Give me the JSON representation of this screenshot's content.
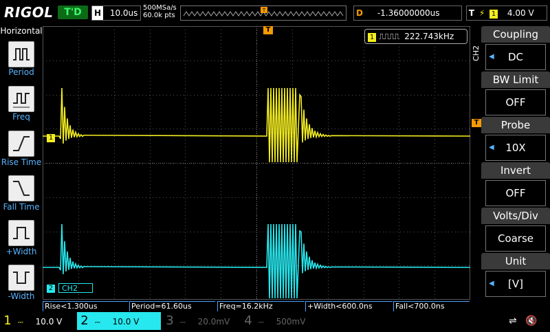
{
  "brand": "RIGOL",
  "trigger_status": "T'D",
  "horizontal": {
    "label": "H",
    "timebase": "10.0us"
  },
  "acquisition": {
    "sample_rate": "500MSa/s",
    "points": "60.0k pts"
  },
  "delay": {
    "label": "D",
    "value": "-1.36000000us"
  },
  "trigger": {
    "label": "T",
    "edge_icon": "rising-edge-icon",
    "source": "1",
    "level": "4.00 V"
  },
  "left_panel": {
    "title": "Horizontal",
    "buttons": [
      {
        "label": "Period",
        "icon": "period-icon"
      },
      {
        "label": "Freq",
        "icon": "freq-icon"
      },
      {
        "label": "Rise Time",
        "icon": "rise-time-icon"
      },
      {
        "label": "Fall Time",
        "icon": "fall-time-icon"
      },
      {
        "label": "+Width",
        "icon": "pos-width-icon"
      },
      {
        "label": "-Width",
        "icon": "neg-width-icon"
      }
    ]
  },
  "freq_counter": {
    "channel": "1",
    "value": "222.743kHz"
  },
  "channel_markers": {
    "ch1": "1",
    "ch2": "2",
    "ch2_label": "CH2",
    "trigger_marker": "T"
  },
  "right_menu": {
    "channel": "CH2",
    "items": [
      {
        "title": "Coupling",
        "value": "DC"
      },
      {
        "title": "BW Limit",
        "value": "OFF"
      },
      {
        "title": "Probe",
        "value": "10X"
      },
      {
        "title": "Invert",
        "value": "OFF"
      },
      {
        "title": "Volts/Div",
        "value": "Coarse"
      },
      {
        "title": "Unit",
        "value": "[V]"
      }
    ]
  },
  "measurements": [
    "Rise<1.300us",
    "Period=61.60us",
    "Freq=16.2kHz",
    "+Width<600.0ns",
    "Fall<700.0ns"
  ],
  "channels": [
    {
      "num": "1",
      "scale": "10.0 V",
      "color": "#f4ee21"
    },
    {
      "num": "2",
      "scale": "10.0 V",
      "color": "#27e8ee"
    },
    {
      "num": "3",
      "scale": "20.0mV",
      "color": "#c05ad8"
    },
    {
      "num": "4",
      "scale": "500mV",
      "color": "#3f6dff"
    }
  ],
  "colors": {
    "ch1": "#f4ee21",
    "ch2": "#27e8ee",
    "accent": "#f59a00",
    "menu_blue": "#5ab4ff"
  }
}
